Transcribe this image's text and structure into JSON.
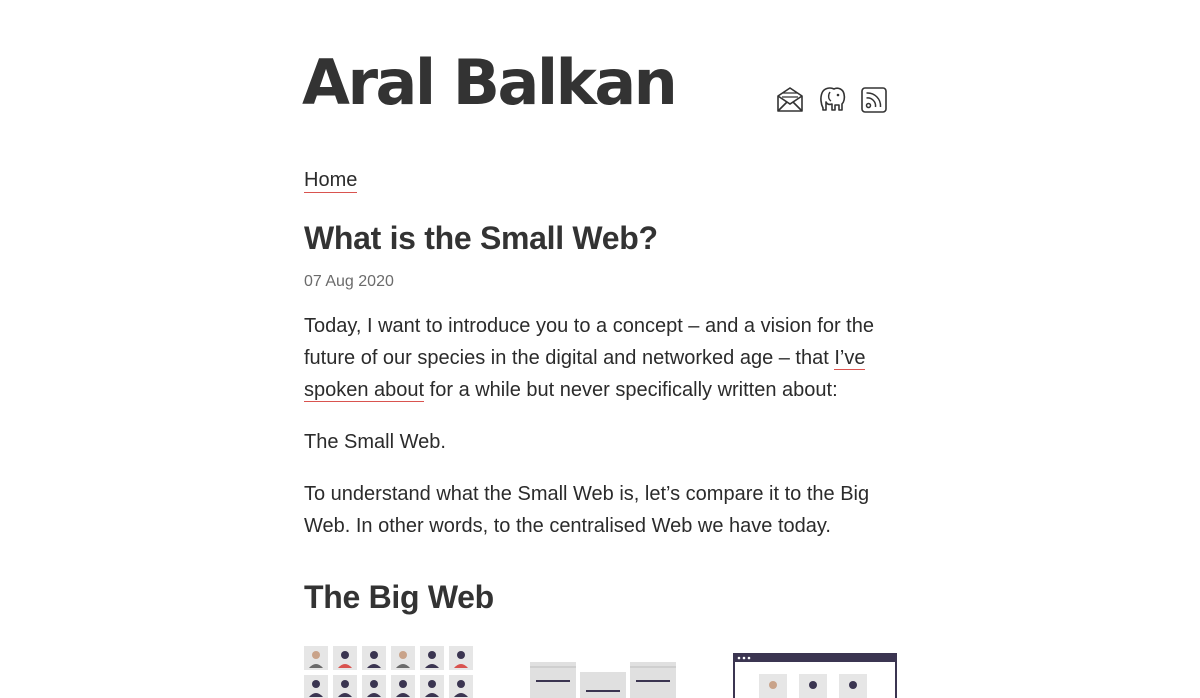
{
  "site": {
    "title": "Aral Balkan",
    "social_icons": [
      "email-icon",
      "mastodon-icon",
      "rss-icon"
    ]
  },
  "nav": {
    "home_label": "Home"
  },
  "post": {
    "title": "What is the Small Web?",
    "date": "07 Aug 2020",
    "p1_before": "Today, I want to introduce you to a concept – and a vision for the future of our species in the digital and networked age – that ",
    "p1_link": "I’ve spoken about",
    "p1_after": " for a while but never specifically written about:",
    "p2": "The Small Web.",
    "p3": "To understand what the Small Web is, let’s compare it to the Big Web. In other words, to the centralised Web we have today.",
    "section_title": "The Big Web"
  },
  "colors": {
    "text": "#2b2b2b",
    "link_underline": "#d9534f",
    "muted": "#6b6b6b",
    "illustration_dark": "#3b3551"
  }
}
